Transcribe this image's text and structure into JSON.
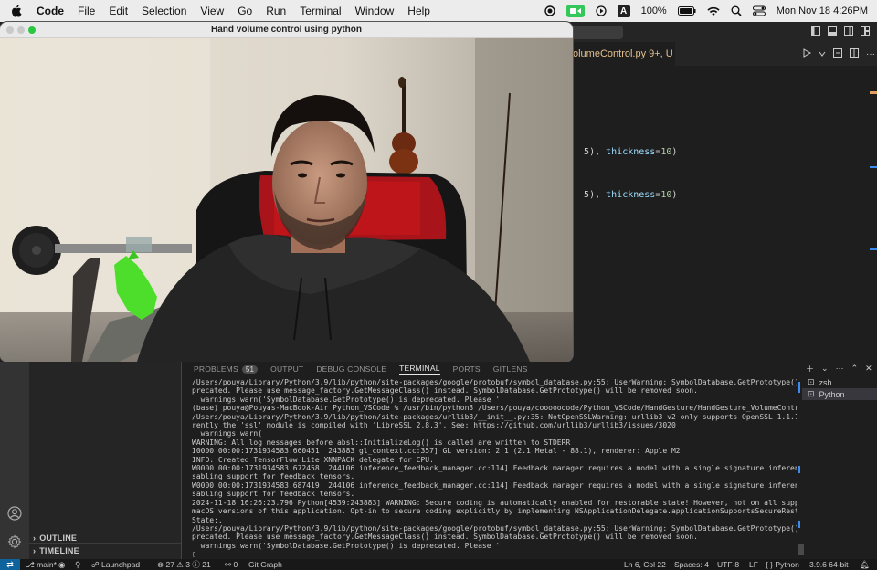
{
  "menubar": {
    "app_name": "Code",
    "items": [
      "File",
      "Edit",
      "Selection",
      "View",
      "Go",
      "Run",
      "Terminal",
      "Window",
      "Help"
    ],
    "battery": "100%",
    "datetime": "Mon Nov 18  4:26PM",
    "keyboard_input": "A"
  },
  "camera_window": {
    "title": "Hand volume control using python"
  },
  "editor": {
    "tab_name": "olumeControl.py",
    "tab_badge": "9+, U",
    "code_lines": [
      {
        "prefix": "5), ",
        "kw": "thickness",
        "eq": "=",
        "num": "10",
        "suffix": ")"
      },
      {
        "prefix": "5), ",
        "kw": "thickness",
        "eq": "=",
        "num": "10",
        "suffix": ")"
      }
    ]
  },
  "sidebar": {
    "outline_label": "OUTLINE",
    "timeline_label": "TIMELINE"
  },
  "panel": {
    "tabs": [
      {
        "label": "PROBLEMS",
        "count": "51"
      },
      {
        "label": "OUTPUT"
      },
      {
        "label": "DEBUG CONSOLE"
      },
      {
        "label": "TERMINAL"
      },
      {
        "label": "PORTS"
      },
      {
        "label": "GITLENS"
      }
    ],
    "terminals": [
      {
        "label": "zsh"
      },
      {
        "label": "Python"
      }
    ]
  },
  "terminal_lines": [
    "/Users/pouya/Library/Python/3.9/lib/python/site-packages/google/protobuf/symbol_database.py:55: UserWarning: SymbolDatabase.GetPrototype() is de",
    "precated. Please use message_factory.GetMessageClass() instead. SymbolDatabase.GetPrototype() will be removed soon.",
    "  warnings.warn('SymbolDatabase.GetPrototype() is deprecated. Please '",
    "(base) pouya@Pouyas-MacBook-Air Python_VSCode % /usr/bin/python3 /Users/pouya/cooooooode/Python_VSCode/HandGesture/HandGesture_VolumeControl.py",
    "/Users/pouya/Library/Python/3.9/lib/python/site-packages/urllib3/__init__.py:35: NotOpenSSLWarning: urllib3 v2 only supports OpenSSL 1.1.1+, cur",
    "rently the 'ssl' module is compiled with 'LibreSSL 2.8.3'. See: https://github.com/urllib3/urllib3/issues/3020",
    "  warnings.warn(",
    "WARNING: All log messages before absl::InitializeLog() is called are written to STDERR",
    "I0000 00:00:1731934583.660451  243883 gl_context.cc:357] GL version: 2.1 (2.1 Metal - 88.1), renderer: Apple M2",
    "INFO: Created TensorFlow Lite XNNPACK delegate for CPU.",
    "W0000 00:00:1731934583.672458  244106 inference_feedback_manager.cc:114] Feedback manager requires a model with a single signature inference. Di",
    "sabling support for feedback tensors.",
    "W0000 00:00:1731934583.687419  244106 inference_feedback_manager.cc:114] Feedback manager requires a model with a single signature inference. Di",
    "sabling support for feedback tensors.",
    "2024-11-18 16:26:23.796 Python[4539:243883] WARNING: Secure coding is automatically enabled for restorable state! However, not on all supported",
    "macOS versions of this application. Opt-in to secure coding explicitly by implementing NSApplicationDelegate.applicationSupportsSecureRestorable",
    "State:.",
    "/Users/pouya/Library/Python/3.9/lib/python/site-packages/google/protobuf/symbol_database.py:55: UserWarning: SymbolDatabase.GetPrototype() is de",
    "precated. Please use message_factory.GetMessageClass() instead. SymbolDatabase.GetPrototype() will be removed soon.",
    "  warnings.warn('SymbolDatabase.GetPrototype() is deprecated. Please '",
    "▯"
  ],
  "statusbar": {
    "branch": "main*",
    "launchpad": "Launchpad",
    "problems": "⊗ 27 ⚠ 3 ⓘ 21",
    "ports": "0",
    "git_graph": "Git Graph",
    "position": "Ln 6, Col 22",
    "spaces": "Spaces: 4",
    "encoding": "UTF-8",
    "eol": "LF",
    "language": "Python",
    "interpreter": "3.9.6 64-bit"
  },
  "icons": [
    "apple-icon",
    "record-icon",
    "facetime-icon",
    "play-icon",
    "wifi-icon",
    "search-icon",
    "control-center-icon",
    "split-icon",
    "run-icon",
    "account-icon",
    "gear-icon",
    "bell-icon"
  ]
}
